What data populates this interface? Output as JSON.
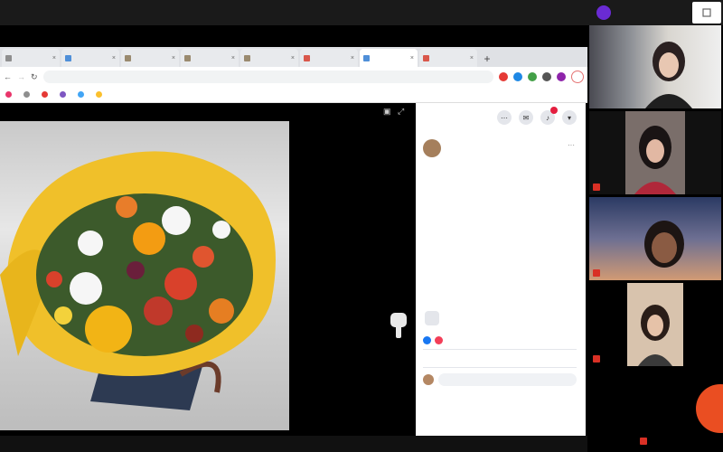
{
  "meeting": {
    "top_left_label": "",
    "presenter": {
      "line1": "",
      "line2": ""
    },
    "participants": [
      {
        "name": ""
      },
      {
        "name": ""
      },
      {
        "name": ""
      },
      {
        "name": ""
      },
      {
        "name": ""
      }
    ]
  },
  "browser": {
    "tabs": [
      {
        "label": "",
        "color": "#8e8e8e"
      },
      {
        "label": "",
        "color": "#4f8fd8"
      },
      {
        "label": "",
        "color": "#9a8a6f"
      },
      {
        "label": "",
        "color": "#9a8a6f"
      },
      {
        "label": "",
        "color": "#9a8a6f"
      },
      {
        "label": "",
        "color": "#d9574b"
      },
      {
        "label": "",
        "color": "#4f8fd8",
        "active": true
      },
      {
        "label": "",
        "color": "#d9574b"
      }
    ],
    "url": "",
    "update_label": "",
    "bookmarks": [
      {
        "label": "",
        "color": "#e9356b"
      },
      {
        "label": "",
        "color": "#8e8e8e"
      },
      {
        "label": "",
        "color": "#e53935"
      },
      {
        "label": "",
        "color": "#7e57c2"
      },
      {
        "label": "",
        "color": "#42a5f5"
      },
      {
        "label": "",
        "color": "#fbc02d"
      }
    ]
  },
  "post": {
    "author_name": "",
    "author_meta": "",
    "text": "",
    "share_label": "",
    "reactions_count": "",
    "comments_count": "",
    "actions": [
      "",
      "",
      ""
    ],
    "comment_placeholder": ""
  }
}
